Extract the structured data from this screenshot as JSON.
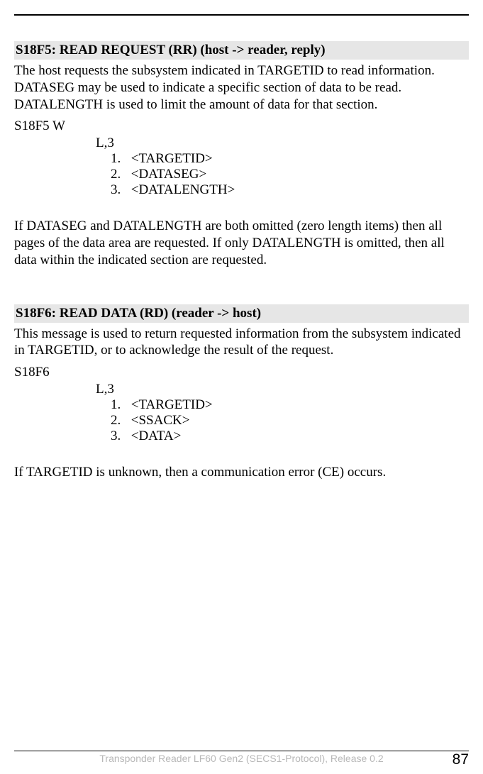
{
  "section1": {
    "heading": "S18F5:  READ REQUEST (RR)  (host -> reader, reply)",
    "para1": "The host requests the subsystem indicated in TARGETID to read information. DATASEG may be used to indicate a specific section of data to be read. DATALENGTH is used to limit the amount of data for that section.",
    "msg_code": "S18F5 W",
    "list_header": "L,3",
    "items": [
      {
        "num": "1.",
        "label": "<TARGETID>"
      },
      {
        "num": "2.",
        "label": "<DATASEG>"
      },
      {
        "num": "3.",
        "label": "<DATALENGTH>"
      }
    ],
    "para2": "If DATASEG and DATALENGTH are both omitted (zero length items) then all pages of the data area are requested. If only DATALENGTH is omitted, then all data within the indicated section are requested."
  },
  "section2": {
    "heading": "S18F6:  READ DATA (RD)  (reader -> host)",
    "para1": "This message is used to return requested information from the subsystem indicated in TARGETID, or to acknowledge the result of the request.",
    "msg_code": "S18F6",
    "list_header": "L,3",
    "items": [
      {
        "num": "1.",
        "label": "<TARGETID>"
      },
      {
        "num": "2.",
        "label": "<SSACK>"
      },
      {
        "num": "3.",
        "label": "<DATA>"
      }
    ],
    "para2": "If TARGETID is unknown, then a communication error (CE) occurs."
  },
  "footer": {
    "text": "Transponder Reader LF60 Gen2 (SECS1-Protocol), Release 0.2",
    "page": "87"
  }
}
